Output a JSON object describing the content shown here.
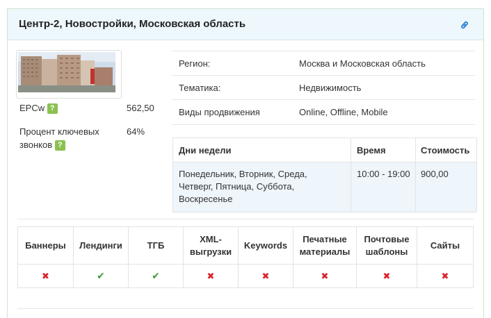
{
  "header": {
    "title": "Центр-2, Новостройки, Московская область",
    "link_icon": "link-icon"
  },
  "photo": {
    "icon": "building-photo"
  },
  "stats": {
    "epc_label": "EPCw",
    "epc_value": "562,50",
    "calls_label_line1": "Процент ключевых",
    "calls_label_line2": "звонков",
    "calls_value": "64%",
    "help_glyph": "?"
  },
  "info": [
    {
      "label": "Регион:",
      "value": "Москва и Московская область"
    },
    {
      "label": "Тематика:",
      "value": "Недвижимость"
    },
    {
      "label": "Виды продвижения",
      "value": "Online, Offline, Mobile"
    }
  ],
  "schedule": {
    "headers": {
      "days": "Дни недели",
      "time": "Время",
      "cost": "Стоимость"
    },
    "row": {
      "days_line1": "Понедельник, Вторник, Среда,",
      "days_line2": "Четверг, Пятница, Суббота,",
      "days_line3": "Воскресенье",
      "time": "10:00 - 19:00",
      "cost": "900,00"
    },
    "row_bg": "#eef5fb"
  },
  "features": {
    "headers": [
      {
        "line1": "Баннеры",
        "line2": ""
      },
      {
        "line1": "Лендинги",
        "line2": ""
      },
      {
        "line1": "ТГБ",
        "line2": ""
      },
      {
        "line1": "XML-",
        "line2": "выгрузки"
      },
      {
        "line1": "Keywords",
        "line2": ""
      },
      {
        "line1": "Печатные",
        "line2": "материалы"
      },
      {
        "line1": "Почтовые",
        "line2": "шаблоны"
      },
      {
        "line1": "Сайты",
        "line2": ""
      }
    ],
    "values": [
      {
        "allowed": false,
        "glyph": "✖",
        "icon": "cross-icon"
      },
      {
        "allowed": true,
        "glyph": "✔",
        "icon": "check-icon"
      },
      {
        "allowed": true,
        "glyph": "✔",
        "icon": "check-icon"
      },
      {
        "allowed": false,
        "glyph": "✖",
        "icon": "cross-icon"
      },
      {
        "allowed": false,
        "glyph": "✖",
        "icon": "cross-icon"
      },
      {
        "allowed": false,
        "glyph": "✖",
        "icon": "cross-icon"
      },
      {
        "allowed": false,
        "glyph": "✖",
        "icon": "cross-icon"
      },
      {
        "allowed": false,
        "glyph": "✖",
        "icon": "cross-icon"
      }
    ],
    "yes_color": "#3f9a37",
    "no_color": "#d9232d"
  },
  "colors": {
    "header_bg": "#eef7fc",
    "help_badge": "#8cc152",
    "link_icon": "#2a7fd4"
  }
}
